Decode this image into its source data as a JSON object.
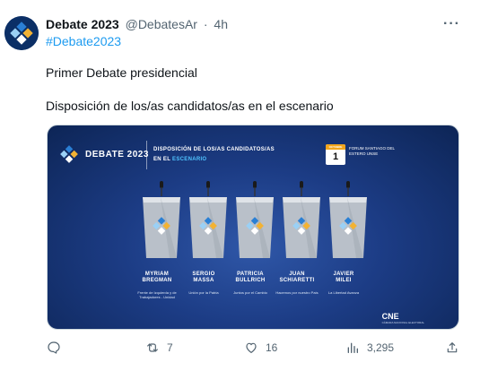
{
  "tweet": {
    "display_name": "Debate 2023",
    "handle": "@DebatesAr",
    "separator": "·",
    "time": "4h",
    "more_label": "···",
    "hashtag": "#Debate2023",
    "line1": "Primer Debate presidencial",
    "line2": "Disposición de los/as candidatos/as en el escenario"
  },
  "media": {
    "title": "DEBATE 2023",
    "subtitle_line1": "DISPOSICIÓN DE LOS/AS CANDIDATOS/AS",
    "subtitle_prefix": "EN EL",
    "subtitle_highlight": "ESCENARIO",
    "calendar_month": "OCTUBRE",
    "calendar_day": "1",
    "venue": "FORUM SANTIAGO DEL ESTERO UNSE",
    "footer_logo": "CNE",
    "footer_logo_sub": "CÁMARA NACIONAL ELECTORAL",
    "candidates": [
      {
        "name_line1": "MYRIAM",
        "name_line2": "BREGMAN",
        "party": "Frente de Izquierda y de Trabajadores - Unidad"
      },
      {
        "name_line1": "SERGIO",
        "name_line2": "MASSA",
        "party": "Unión por la Patria"
      },
      {
        "name_line1": "PATRICIA",
        "name_line2": "BULLRICH",
        "party": "Juntos por el Cambio"
      },
      {
        "name_line1": "JUAN",
        "name_line2": "SCHIARETTI",
        "party": "Hacemos por nuestro País"
      },
      {
        "name_line1": "JAVIER",
        "name_line2": "MILEI",
        "party": "La Libertad Avanza"
      }
    ]
  },
  "actions": {
    "reply_count": "",
    "retweet_count": "7",
    "like_count": "16",
    "views_count": "3,295"
  },
  "icons": {
    "reply": "reply-icon",
    "retweet": "retweet-icon",
    "like": "heart-icon",
    "views": "views-icon",
    "share": "share-icon"
  },
  "colors": {
    "link": "#1d9bf0",
    "text_secondary": "#536471",
    "media_bg": "#1c3c85",
    "highlight": "#4fc3ff",
    "calendar_accent": "#f2a51c"
  }
}
